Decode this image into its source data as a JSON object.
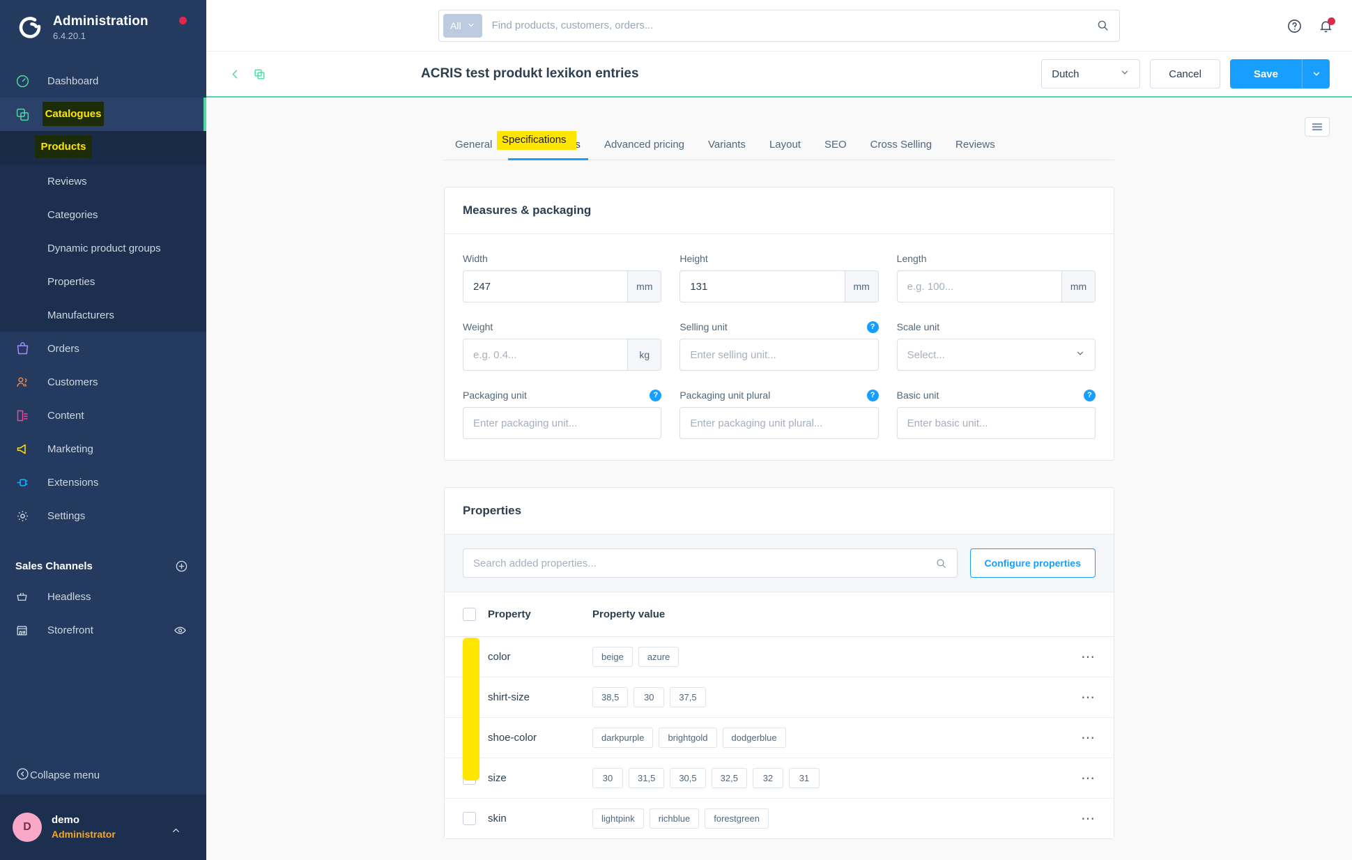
{
  "sidebar": {
    "brand": {
      "title": "Administration",
      "version": "6.4.20.1"
    },
    "nav": [
      {
        "label": "Dashboard",
        "icon": "dashboard-icon"
      },
      {
        "label": "Catalogues",
        "icon": "catalogue-icon",
        "highlighted": true
      },
      {
        "label": "Orders",
        "icon": "orders-icon"
      },
      {
        "label": "Customers",
        "icon": "customers-icon"
      },
      {
        "label": "Content",
        "icon": "content-icon"
      },
      {
        "label": "Marketing",
        "icon": "marketing-icon"
      },
      {
        "label": "Extensions",
        "icon": "extensions-icon"
      },
      {
        "label": "Settings",
        "icon": "settings-icon"
      }
    ],
    "catalogue_children": [
      {
        "label": "Products",
        "highlighted": true
      },
      {
        "label": "Reviews"
      },
      {
        "label": "Categories"
      },
      {
        "label": "Dynamic product groups"
      },
      {
        "label": "Properties"
      },
      {
        "label": "Manufacturers"
      }
    ],
    "sales_channels": {
      "title": "Sales Channels",
      "add_icon": "plus-circle-icon",
      "items": [
        {
          "label": "Headless",
          "icon": "basket-icon"
        },
        {
          "label": "Storefront",
          "icon": "storefront-icon",
          "trailing_icon": "eye-icon"
        }
      ]
    },
    "collapse": {
      "label": "Collapse menu",
      "icon": "collapse-icon"
    },
    "user": {
      "initial": "D",
      "name": "demo",
      "role": "Administrator",
      "caret": "chevron-up-icon"
    }
  },
  "topbar": {
    "scope_label": "All",
    "scope_caret": "chevron-down-icon",
    "search_placeholder": "Find products, customers, orders...",
    "search_value": "",
    "search_icon": "search-icon",
    "help_icon": "help-circle-icon",
    "notifications_icon": "bell-icon",
    "has_notification": true
  },
  "smartbar": {
    "back_icon": "chevron-left-icon",
    "duplicate_icon": "duplicate-icon",
    "heading": "ACRIS test produkt lexikon entries",
    "language": "Dutch",
    "language_caret": "chevron-down-icon",
    "cancel_label": "Cancel",
    "save_label": "Save",
    "save_caret": "chevron-down-icon"
  },
  "content": {
    "list_toggle_icon": "list-view-icon",
    "tabs": [
      {
        "label": "General",
        "active": false
      },
      {
        "label": "Specifications",
        "active": true,
        "highlighted": true
      },
      {
        "label": "Advanced pricing",
        "active": false
      },
      {
        "label": "Variants",
        "active": false
      },
      {
        "label": "Layout",
        "active": false
      },
      {
        "label": "SEO",
        "active": false
      },
      {
        "label": "Cross Selling",
        "active": false
      },
      {
        "label": "Reviews",
        "active": false
      }
    ],
    "measures_card": {
      "title": "Measures & packaging",
      "fields": [
        {
          "label": "Width",
          "value": "247",
          "placeholder": "e.g. 100...",
          "unit": "mm",
          "type": "unit"
        },
        {
          "label": "Height",
          "value": "131",
          "placeholder": "e.g. 100...",
          "unit": "mm",
          "type": "unit"
        },
        {
          "label": "Length",
          "value": "",
          "placeholder": "e.g. 100...",
          "unit": "mm",
          "type": "unit"
        },
        {
          "label": "Weight",
          "value": "",
          "placeholder": "e.g. 0.4...",
          "unit": "kg",
          "type": "unit"
        },
        {
          "label": "Selling unit",
          "value": "",
          "placeholder": "Enter selling unit...",
          "type": "text",
          "help": "?"
        },
        {
          "label": "Scale unit",
          "value": "",
          "placeholder": "Select...",
          "type": "select",
          "caret": "chevron-down-icon"
        },
        {
          "label": "Packaging unit",
          "value": "",
          "placeholder": "Enter packaging unit...",
          "type": "text",
          "help": "?"
        },
        {
          "label": "Packaging unit plural",
          "value": "",
          "placeholder": "Enter packaging unit plural...",
          "type": "text",
          "help": "?"
        },
        {
          "label": "Basic unit",
          "value": "",
          "placeholder": "Enter basic unit...",
          "type": "text",
          "help": "?"
        }
      ]
    },
    "properties_card": {
      "title": "Properties",
      "search_placeholder": "Search added properties...",
      "search_value": "",
      "search_icon": "search-icon",
      "configure_label": "Configure properties",
      "columns": {
        "property": "Property",
        "value": "Property value"
      },
      "rows": [
        {
          "property": "color",
          "values": [
            "beige",
            "azure"
          ]
        },
        {
          "property": "shirt-size",
          "values": [
            "38,5",
            "30",
            "37,5"
          ]
        },
        {
          "property": "shoe-color",
          "values": [
            "darkpurple",
            "brightgold",
            "dodgerblue"
          ]
        },
        {
          "property": "size",
          "values": [
            "30",
            "31,5",
            "30,5",
            "32,5",
            "32",
            "31"
          ]
        },
        {
          "property": "skin",
          "values": [
            "lightpink",
            "richblue",
            "forestgreen"
          ]
        }
      ],
      "row_menu_icon": "ellipsis-icon"
    }
  },
  "annotations": {
    "highlight_color": "#ffe600",
    "sidebar_highlight_bg": "#1c2b08",
    "sidebar_highlight_fg": "#ffe600",
    "items": [
      {
        "target": "sidebar-item-catalogues",
        "label": "Catalogues"
      },
      {
        "target": "sidebar-item-products",
        "label": "Products"
      },
      {
        "target": "tab-specifications",
        "label": "Specifications"
      },
      {
        "target": "properties-checkbox-column",
        "label": ""
      }
    ]
  },
  "colors": {
    "sidebar_bg": "#253a5f",
    "accent_green": "#51d8a0",
    "accent_blue": "#189eff",
    "danger": "#de294c",
    "avatar": "#f9a8c8",
    "role": "#f5a623"
  }
}
